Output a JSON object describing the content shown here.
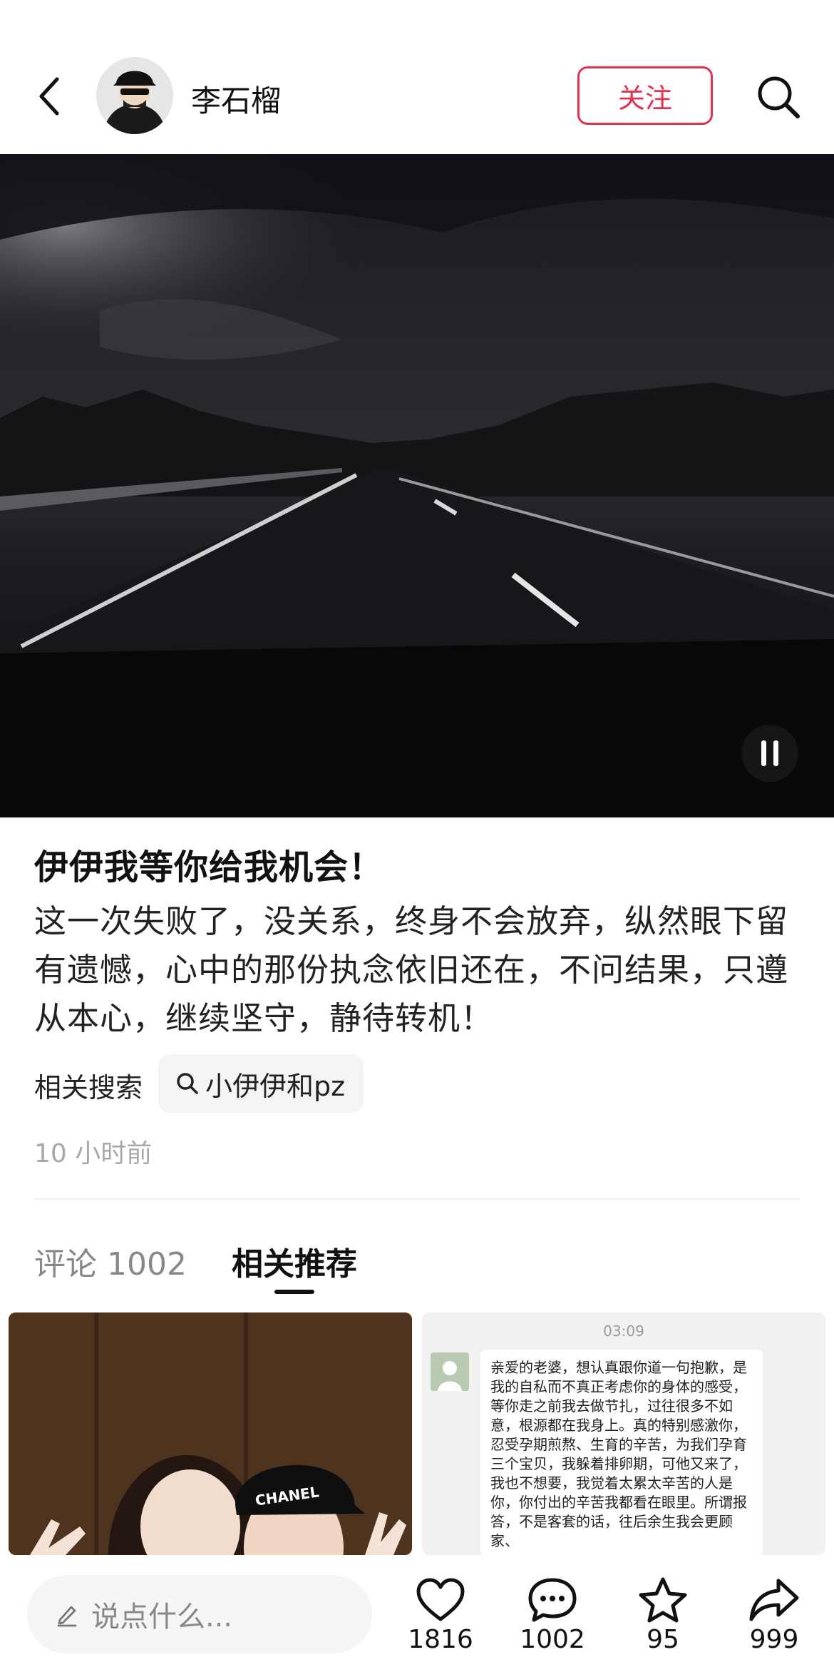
{
  "header": {
    "username": "李石榴",
    "follow_label": "关注"
  },
  "post": {
    "title": "伊伊我等你给我机会！",
    "body": "这一次失败了，没关系，终身不会放弃，纵然眼下留有遗憾，心中的那份执念依旧还在，不问结果，只遵从本心，继续坚守，静待转机！",
    "related_search_label": "相关搜索",
    "related_search_query": "小伊伊和pz",
    "time": "10 小时前"
  },
  "tabs": [
    {
      "label": "评论 1002"
    },
    {
      "label": "相关推荐"
    }
  ],
  "recommend": {
    "card2_time": "03:09",
    "card2_message": "亲爱的老婆，想认真跟你道一句抱歉，是我的自私而不真正考虑你的身体的感受，等你走之前我去做节扎，过往很多不如意，根源都在我身上。真的特别感激你，忍受孕期煎熬、生育的辛苦，为我们孕育三个宝贝，我躲着排卵期，可他又来了，我也不想要，我觉着太累太辛苦的人是你，你付出的辛苦我都看在眼里。所谓报答，不是客套的话，往后余生我会更顾家、",
    "card1_cap_text": "CHANEL"
  },
  "bottom_bar": {
    "input_placeholder": "说点什么...",
    "like_count": "1816",
    "comment_count": "1002",
    "fav_count": "95",
    "share_count": "999"
  },
  "colors": {
    "accent": "#e1334e",
    "muted": "#a8a8a8"
  },
  "icons": {
    "back": "chevron-left-icon",
    "search": "search-icon",
    "fullscreen": "scan-icon",
    "pause": "pause-icon",
    "like": "heart-icon",
    "comment": "chat-bubble-icon",
    "favorite": "star-icon",
    "share": "share-arrow-icon",
    "pen": "pen-icon"
  }
}
